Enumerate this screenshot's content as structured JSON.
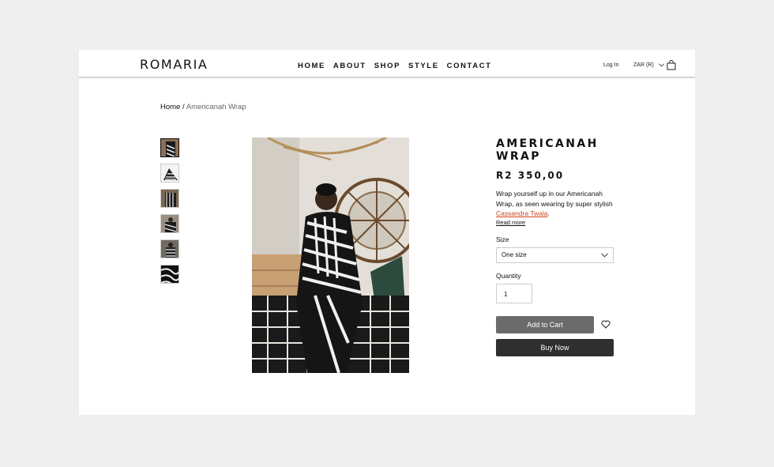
{
  "header": {
    "logo": "ROMARIA",
    "nav": [
      "HOME",
      "ABOUT",
      "SHOP",
      "STYLE",
      "CONTACT"
    ],
    "login": "Log In",
    "currency": "ZAR (R)",
    "cart_icon": "shopping-bag-icon"
  },
  "breadcrumb": {
    "home": "Home",
    "separator": " / ",
    "current": "Americanah Wrap"
  },
  "product": {
    "title": "AMERICANAH WRAP",
    "price": "R2 350,00",
    "description_prefix": "Wrap yourself up in our Americanah Wrap, as seen wearing by super stylish ",
    "description_link": "Cassandra Twala",
    "description_suffix": ".",
    "read_more": "Read more",
    "size_label": "Size",
    "size_value": "One size",
    "quantity_label": "Quantity",
    "quantity_value": "1",
    "add_to_cart": "Add to Cart",
    "buy_now": "Buy Now",
    "wishlist_icon": "heart-icon"
  },
  "colors": {
    "link": "#c9461b",
    "add_to_cart_bg": "#6b6b6b",
    "buy_now_bg": "#2f2f2f"
  }
}
